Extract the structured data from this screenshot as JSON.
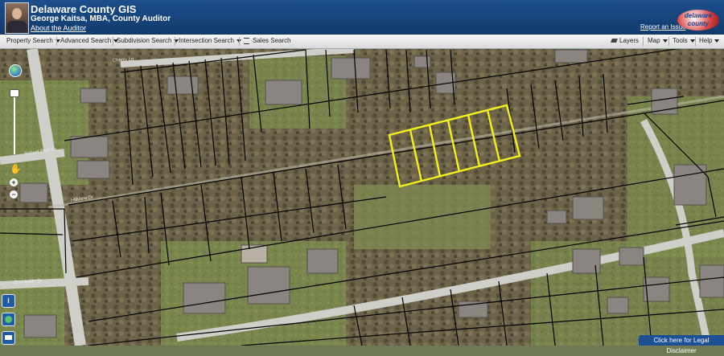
{
  "header": {
    "title": "Delaware County GIS",
    "subtitle": "George Kaitsa, MBA, County Auditor",
    "about_link": "About the Auditor",
    "report_link": "Report an Issue",
    "logo_top": "delaware",
    "logo_bottom": "county"
  },
  "toolbar": {
    "left": [
      "Property Search",
      "Advanced Search",
      "Subdivision Search",
      "Intersection Search",
      "Sales Search"
    ],
    "right": [
      "Layers",
      "Map",
      "Tools",
      "Help"
    ]
  },
  "map": {
    "road_labels": [
      "Sunset Park Dr",
      "Cherry Ln",
      "Hillview Dr",
      "Brookside Dr"
    ],
    "highlight_color": "#f3f21a",
    "parcel_line_color": "#000000"
  },
  "side_buttons": {
    "info": "i",
    "basemap": "globe",
    "print": "camera"
  },
  "footer": {
    "disclaimer": "Click here for Legal Disclaimer"
  }
}
